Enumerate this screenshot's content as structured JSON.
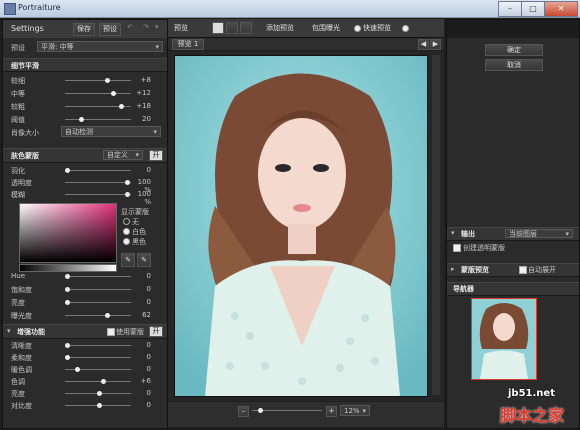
{
  "window": {
    "title": "Portraiture"
  },
  "left": {
    "settings_label": "Settings",
    "save_label": "保存",
    "preset_label": "预设",
    "preset_row_label": "预设",
    "preset_value": "平滑: 中等",
    "detail_section": "细节平滑",
    "sliders": [
      {
        "label": "较细",
        "value": "+8"
      },
      {
        "label": "中等",
        "value": "+12"
      },
      {
        "label": "较粗",
        "value": "+18"
      },
      {
        "label": "阈值",
        "value": "20"
      }
    ],
    "portrait_size_label": "肖像大小",
    "portrait_size_value": "自动检测",
    "skin_mask_section": "肤色蒙版",
    "skin_mask_mode": "自定义",
    "skin_mask_toggle": "开",
    "mask_sliders": [
      {
        "label": "羽化",
        "value": "0"
      },
      {
        "label": "透明度",
        "value": "100 %"
      },
      {
        "label": "模糊",
        "value": "100 %"
      }
    ],
    "show_mask_label": "显示蒙版",
    "show_mask_options": [
      "无",
      "白色",
      "黑色"
    ],
    "hsl_sliders": [
      {
        "label": "Hue",
        "value": "0"
      },
      {
        "label": "饱和度",
        "value": "0"
      },
      {
        "label": "亮度",
        "value": "0"
      },
      {
        "label": "曝光度",
        "value": "62"
      }
    ],
    "enhance_section": "增强功能",
    "use_mask_label": "使用蒙版",
    "enhance_toggle": "开",
    "enhance_sliders": [
      {
        "label": "清晰度",
        "value": "0"
      },
      {
        "label": "柔和度",
        "value": "0"
      },
      {
        "label": "暖色调",
        "value": "0"
      },
      {
        "label": "色调",
        "value": "+6"
      },
      {
        "label": "亮度",
        "value": "0"
      },
      {
        "label": "对比度",
        "value": "0"
      }
    ]
  },
  "toolbar": {
    "preview_label": "预览",
    "add_preview_label": "添加预览",
    "clip_exposure_label": "包围曝光",
    "fast_preview_label": "快速预览",
    "tab_label": "预览 1",
    "zoom_value": "12%"
  },
  "right": {
    "ok_label": "确定",
    "cancel_label": "取消",
    "output_section": "输出",
    "output_value": "当前图层",
    "create_mask_label": "创建透明蒙版",
    "mask_preview_section": "蒙版预览",
    "auto_expand_label": "自动展开",
    "navigator_section": "导航器"
  },
  "watermark": {
    "site": "jb51.net",
    "brand": "脚本之家"
  },
  "colors": {
    "accent": "#7fc8cf",
    "panel": "#2b2b2b",
    "header": "#3a3a3a",
    "brand_red": "#e03a2c"
  }
}
